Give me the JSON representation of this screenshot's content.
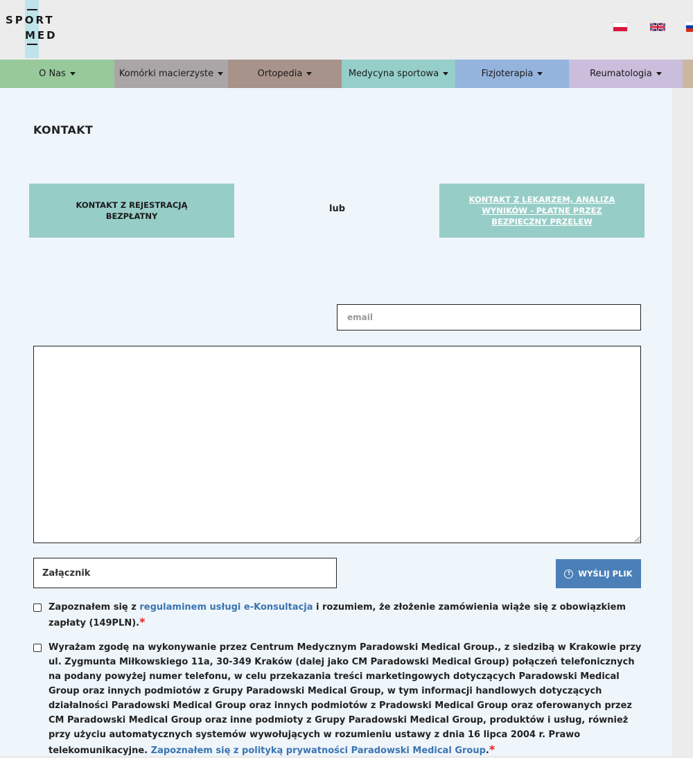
{
  "logo": {
    "line1": "SPORT",
    "line2": "MED"
  },
  "languages": [
    "pl-flag",
    "gb-flag",
    "ru-flag"
  ],
  "nav": [
    {
      "label": "O Nas",
      "color": "#97c99b"
    },
    {
      "label": "Komórki macierzyste",
      "color": "#aaa6a8"
    },
    {
      "label": "Ortopedia",
      "color": "#a8938a"
    },
    {
      "label": "Medycyna sportowa",
      "color": "#96cfca"
    },
    {
      "label": "Fizjoterapia",
      "color": "#94b4dd"
    },
    {
      "label": "Reumatologia",
      "color": "#cbbddc"
    },
    {
      "label": "",
      "color": "#c9b7a1"
    }
  ],
  "page": {
    "title": "KONTAKT",
    "btn_registration": "KONTAKT Z REJESTRACJĄ BEZPŁATNY",
    "or": "lub",
    "btn_doctor": "KONTAKT Z LEKARZEM, ANALIZA WYNIKÓW - PŁATNE PRZEZ BEZPIECZNY PRZELEW",
    "email_placeholder": "email",
    "message_value": "",
    "attachment_label": "Załącznik",
    "upload_button": "WYŚLIJ PLIK"
  },
  "consents": [
    {
      "before": "Zapoznałem się z ",
      "link": "regulaminem usługi e-Konsultacja",
      "after": " i rozumiem, że złożenie zamówienia wiąże się z obowiązkiem zapłaty (149PLN).",
      "required_mark": "*"
    },
    {
      "before": "Wyrażam zgodę na wykonywanie przez Centrum Medycznym Paradowski Medical Group.,  z siedzibą w Krakowie przy ul. Zygmunta Miłkowskiego 11a, 30-349 Kraków (dalej jako CM Paradowski Medical Group) połączeń telefonicznych na podany powyżej numer telefonu, w celu przekazania treści marketingowych dotyczących Paradowski Medical Group oraz innych podmiotów z Grupy Paradowski Medical Group, w tym informacji handlowych dotyczących działalności Paradowski Medical Group oraz innych podmiotów z Pradowski Medical Group oraz oferowanych przez CM Paradowski Medical Group oraz inne podmioty z Grupy Paradowski Medical Group, produktów i usług, również przy użyciu automatycznych systemów wywołujących w rozumieniu ustawy z dnia 16 lipca 2004 r. Prawo telekomunikacyjne. ",
      "link": "Zapoznałem się z polityką prywatności Paradowski Medical Group",
      "after": ".",
      "required_mark": "*"
    }
  ]
}
